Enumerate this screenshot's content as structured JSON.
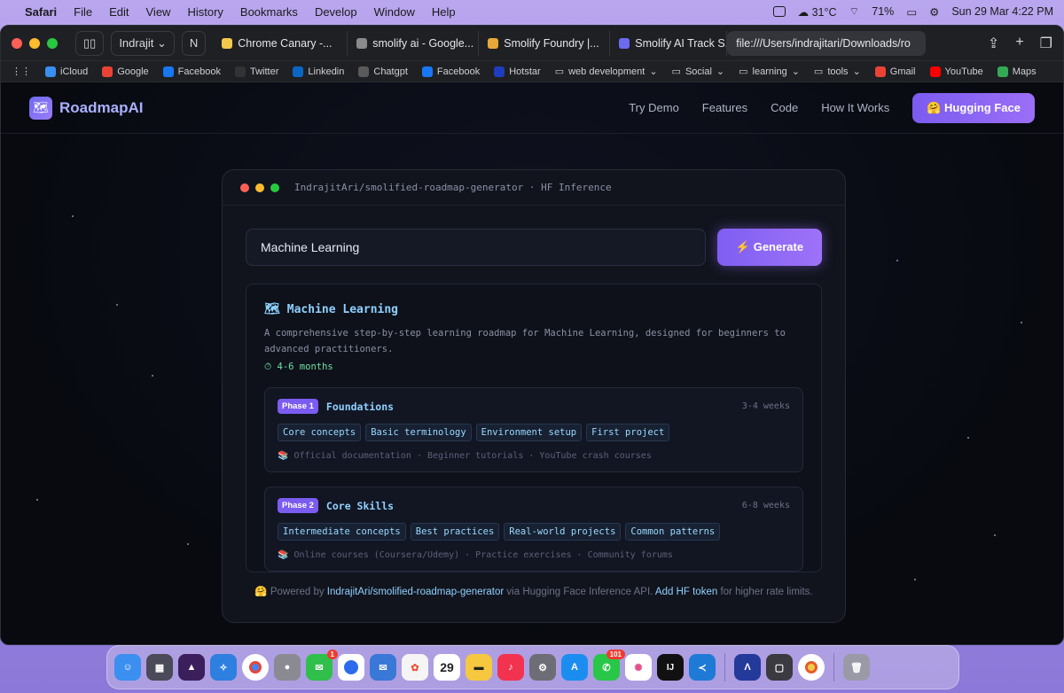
{
  "menubar": {
    "app": "Safari",
    "items": [
      "File",
      "Edit",
      "View",
      "History",
      "Bookmarks",
      "Develop",
      "Window",
      "Help"
    ],
    "weather": "31°C",
    "battery": "71%",
    "datetime": "Sun 29 Mar  4:22 PM"
  },
  "browser": {
    "profile": "Indrajit",
    "tabs": [
      {
        "label": "Chrome Canary -...",
        "color": "#f2c94c"
      },
      {
        "label": "smolify ai - Google...",
        "color": "#8a8a8a"
      },
      {
        "label": "Smolify Foundry |...",
        "color": "#e8a838"
      },
      {
        "label": "Smolify AI Track S...",
        "color": "#6b6bf0"
      }
    ],
    "address": "file:///Users/indrajitari/Downloads/ro",
    "bookmarks": [
      {
        "label": "iCloud",
        "color": "#3a8ef0"
      },
      {
        "label": "Google",
        "color": "#ea4335"
      },
      {
        "label": "Facebook",
        "color": "#1877f2"
      },
      {
        "label": "Twitter",
        "color": "#333333"
      },
      {
        "label": "Linkedin",
        "color": "#0a66c2"
      },
      {
        "label": "Chatgpt",
        "color": "#5a5a5a"
      },
      {
        "label": "Facebook",
        "color": "#1877f2"
      },
      {
        "label": "Hotstar",
        "color": "#1f3cbd"
      },
      {
        "label": "web development",
        "color": "#777777"
      },
      {
        "label": "Social",
        "color": "#777777"
      },
      {
        "label": "learning",
        "color": "#777777"
      },
      {
        "label": "tools",
        "color": "#777777"
      },
      {
        "label": "Gmail",
        "color": "#ea4335"
      },
      {
        "label": "YouTube",
        "color": "#ff0000"
      },
      {
        "label": "Maps",
        "color": "#34a853"
      }
    ]
  },
  "site": {
    "logo": "RoadmapAI",
    "nav": [
      "Try Demo",
      "Features",
      "Code",
      "How It Works"
    ],
    "cta": "🤗 Hugging Face"
  },
  "demo": {
    "header": "IndrajitAri/smolified-roadmap-generator · HF Inference",
    "input_value": "Machine Learning",
    "generate_label": "⚡ Generate",
    "result": {
      "title": "Machine Learning",
      "description": "A comprehensive step-by-step learning roadmap for Machine Learning, designed for beginners to advanced practitioners.",
      "duration": "⏱ 4-6 months",
      "phases": [
        {
          "badge": "Phase 1",
          "name": "Foundations",
          "duration": "3-4 weeks",
          "tags": [
            "Core concepts",
            "Basic terminology",
            "Environment setup",
            "First project"
          ],
          "resources": "📚 Official documentation · Beginner tutorials · YouTube crash courses"
        },
        {
          "badge": "Phase 2",
          "name": "Core Skills",
          "duration": "6-8 weeks",
          "tags": [
            "Intermediate concepts",
            "Best practices",
            "Real-world projects",
            "Common patterns"
          ],
          "resources": "📚 Online courses (Coursera/Udemy) · Practice exercises · Community forums"
        }
      ]
    },
    "footer": {
      "prefix": "🤗 Powered by",
      "model_link": "IndrajitAri/smolified-roadmap-generator",
      "middle": "via Hugging Face Inference API.",
      "token_link": "Add HF token",
      "suffix": "for higher rate limits."
    }
  },
  "dock": {
    "calendar_day": "29",
    "messages_badge": "1",
    "whatsapp_badge": "101"
  }
}
